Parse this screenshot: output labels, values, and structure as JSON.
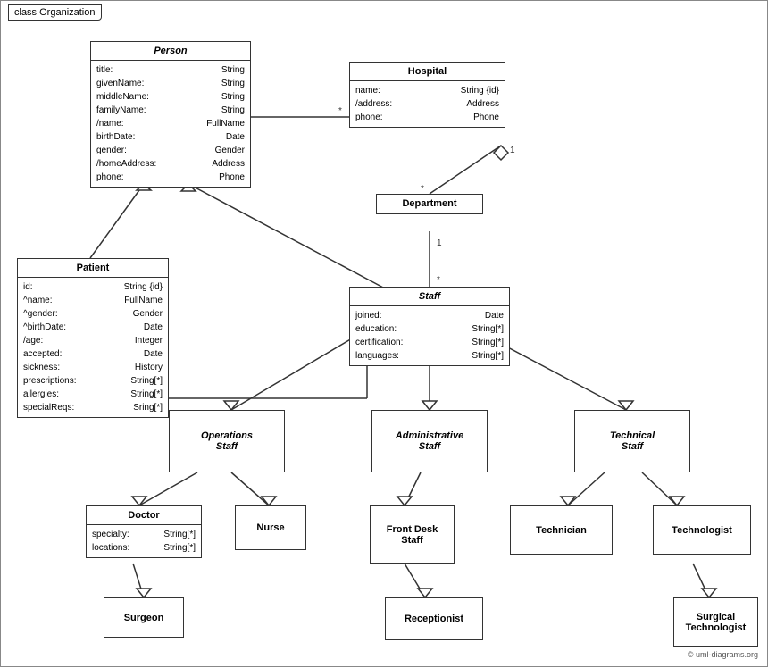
{
  "diagram": {
    "title": "class Organization",
    "copyright": "© uml-diagrams.org",
    "classes": {
      "person": {
        "name": "Person",
        "attrs": [
          [
            "title:",
            "String"
          ],
          [
            "givenName:",
            "String"
          ],
          [
            "middleName:",
            "String"
          ],
          [
            "familyName:",
            "String"
          ],
          [
            "/name:",
            "FullName"
          ],
          [
            "birthDate:",
            "Date"
          ],
          [
            "gender:",
            "Gender"
          ],
          [
            "/homeAddress:",
            "Address"
          ],
          [
            "phone:",
            "Phone"
          ]
        ]
      },
      "hospital": {
        "name": "Hospital",
        "attrs": [
          [
            "name:",
            "String {id}"
          ],
          [
            "/address:",
            "Address"
          ],
          [
            "phone:",
            "Phone"
          ]
        ]
      },
      "department": {
        "name": "Department"
      },
      "staff": {
        "name": "Staff",
        "attrs": [
          [
            "joined:",
            "Date"
          ],
          [
            "education:",
            "String[*]"
          ],
          [
            "certification:",
            "String[*]"
          ],
          [
            "languages:",
            "String[*]"
          ]
        ]
      },
      "patient": {
        "name": "Patient",
        "attrs": [
          [
            "id:",
            "String {id}"
          ],
          [
            "^name:",
            "FullName"
          ],
          [
            "^gender:",
            "Gender"
          ],
          [
            "^birthDate:",
            "Date"
          ],
          [
            "/age:",
            "Integer"
          ],
          [
            "accepted:",
            "Date"
          ],
          [
            "sickness:",
            "History"
          ],
          [
            "prescriptions:",
            "String[*]"
          ],
          [
            "allergies:",
            "String[*]"
          ],
          [
            "specialReqs:",
            "Sring[*]"
          ]
        ]
      },
      "operations_staff": {
        "name": "Operations\nStaff"
      },
      "admin_staff": {
        "name": "Administrative\nStaff"
      },
      "technical_staff": {
        "name": "Technical\nStaff"
      },
      "doctor": {
        "name": "Doctor",
        "attrs": [
          [
            "specialty:",
            "String[*]"
          ],
          [
            "locations:",
            "String[*]"
          ]
        ]
      },
      "nurse": {
        "name": "Nurse"
      },
      "front_desk": {
        "name": "Front Desk\nStaff"
      },
      "technician": {
        "name": "Technician"
      },
      "technologist": {
        "name": "Technologist"
      },
      "surgeon": {
        "name": "Surgeon"
      },
      "receptionist": {
        "name": "Receptionist"
      },
      "surgical_tech": {
        "name": "Surgical\nTechnologist"
      }
    }
  }
}
